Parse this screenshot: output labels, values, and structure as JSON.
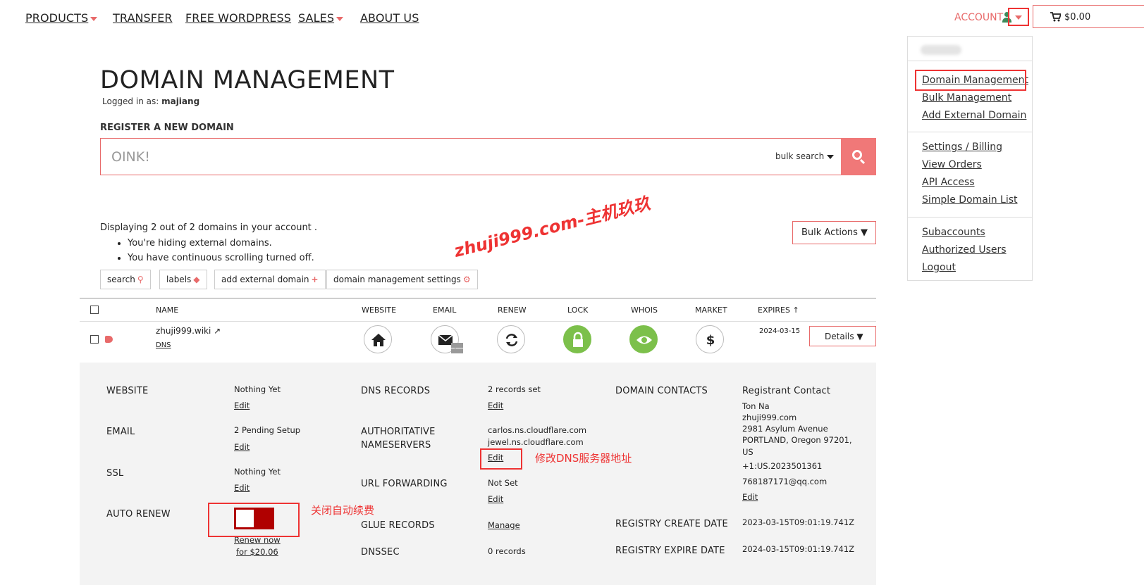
{
  "nav": {
    "products": "PRODUCTS",
    "transfer": "TRANSFER",
    "free_wordpress": "FREE WORDPRESS",
    "sales": "SALES",
    "about_us": "ABOUT US",
    "account": "ACCOUNT",
    "cart_total": "$0.00"
  },
  "dropdown": {
    "group1": [
      "Domain Management",
      "Bulk Management",
      "Add External Domain"
    ],
    "group2": [
      "Settings / Billing",
      "View Orders",
      "API Access",
      "Simple Domain List"
    ],
    "group3": [
      "Subaccounts",
      "Authorized Users",
      "Logout"
    ]
  },
  "page": {
    "title": "DOMAIN MANAGEMENT",
    "logged_in_prefix": "Logged in as: ",
    "username": "majiang",
    "register_label": "REGISTER A NEW DOMAIN",
    "search_placeholder": "OINK!",
    "bulk_search": "bulk search",
    "displaying": "Displaying 2 out of 2 domains in your account .",
    "bullets": [
      "You're hiding external domains.",
      "You have continuous scrolling turned off."
    ],
    "bulk_actions": "Bulk Actions ▼",
    "tools": {
      "search": "search",
      "labels": "labels",
      "add_external": "add external domain",
      "settings": "domain management settings"
    },
    "watermark": "zhuji999.com-主机玖玖"
  },
  "table": {
    "headers": {
      "name": "NAME",
      "website": "WEBSITE",
      "email": "EMAIL",
      "renew": "RENEW",
      "lock": "LOCK",
      "whois": "WHOIS",
      "market": "MARKET",
      "expires": "EXPIRES"
    },
    "row": {
      "domain": "zhuji999.wiki",
      "dns": "DNS",
      "expires": "2024-03-15",
      "details": "Details ▼"
    }
  },
  "details": {
    "website_label": "WEBSITE",
    "website_value": "Nothing Yet",
    "email_label": "EMAIL",
    "email_value": "2 Pending Setup",
    "ssl_label": "SSL",
    "ssl_value": "Nothing Yet",
    "auto_renew_label": "AUTO RENEW",
    "renew_now": "Renew now",
    "renew_price": "for $20.06",
    "edit": "Edit",
    "dns_records_label": "DNS RECORDS",
    "dns_records_value": "2 records set",
    "auth_ns_label_1": "AUTHORITATIVE",
    "auth_ns_label_2": "NAMESERVERS",
    "ns1": "carlos.ns.cloudflare.com",
    "ns2": "jewel.ns.cloudflare.com",
    "url_forwarding_label": "URL FORWARDING",
    "url_forwarding_value": "Not Set",
    "glue_label": "GLUE RECORDS",
    "glue_value": "Manage",
    "dnssec_label": "DNSSEC",
    "dnssec_value": "0 records",
    "contacts_label": "DOMAIN CONTACTS",
    "registrant_title": "Registrant Contact",
    "registrant_name": "Ton Na",
    "registrant_org": "zhuji999.com",
    "registrant_addr1": "2981 Asylum Avenue",
    "registrant_addr2": "PORTLAND, Oregon 97201,",
    "registrant_country": "US",
    "registrant_phone": "+1:US.2023501361",
    "registrant_email": "768187171@qq.com",
    "create_label": "REGISTRY CREATE DATE",
    "create_value": "2023-03-15T09:01:19.741Z",
    "expire_label": "REGISTRY EXPIRE DATE",
    "expire_value": "2024-03-15T09:01:19.741Z"
  },
  "annotations": {
    "dns_note": "修改DNS服务器地址",
    "renew_note": "关闭自动续费"
  },
  "colors": {
    "accent": "#e86a6a",
    "annotation": "#e33333",
    "toggle_off": "#b00000",
    "lock_green": "#7cc04b"
  }
}
